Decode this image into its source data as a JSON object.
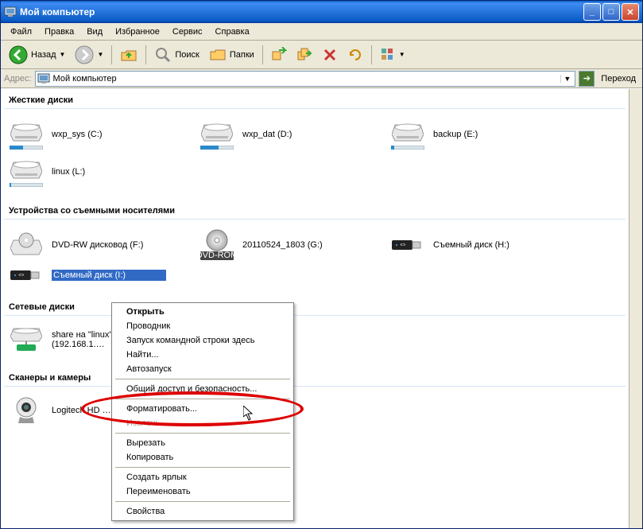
{
  "window": {
    "title": "Мой компьютер",
    "controls": {
      "min": "_",
      "max": "□",
      "close": "✕"
    }
  },
  "menubar": [
    "Файл",
    "Правка",
    "Вид",
    "Избранное",
    "Сервис",
    "Справка"
  ],
  "toolbar": {
    "back": "Назад",
    "search": "Поиск",
    "folders": "Папки"
  },
  "addressbar": {
    "label": "Адрес:",
    "value": "Мой компьютер",
    "go": "Переход"
  },
  "groups": [
    {
      "title": "Жесткие диски",
      "items": [
        {
          "name": "wxp_sys (C:)",
          "type": "hdd",
          "fill": 0.4
        },
        {
          "name": "wxp_dat (D:)",
          "type": "hdd",
          "fill": 0.55
        },
        {
          "name": "backup (E:)",
          "type": "hdd",
          "fill": 0.1
        },
        {
          "name": "linux (L:)",
          "type": "hdd",
          "fill": 0.05
        }
      ]
    },
    {
      "title": "Устройства со съемными носителями",
      "items": [
        {
          "name": "DVD-RW дисковод (F:)",
          "type": "dvdrw"
        },
        {
          "name": "20110524_1803 (G:)",
          "type": "dvdrom",
          "badge": "DVD-ROM"
        },
        {
          "name": "Съемный диск (H:)",
          "type": "usb"
        },
        {
          "name": "Съемный диск (I:)",
          "type": "usb",
          "selected": true
        }
      ]
    },
    {
      "title": "Сетевые диски",
      "items": [
        {
          "name": "share на \"linux\" (Z:)",
          "sub": "(192.168.1.…",
          "type": "netdrive"
        }
      ]
    },
    {
      "title": "Сканеры и камеры",
      "items": [
        {
          "name": "Logitech HD …",
          "type": "webcam"
        }
      ]
    }
  ],
  "context_menu": [
    {
      "label": "Открыть",
      "bold": true
    },
    {
      "label": "Проводник"
    },
    {
      "label": "Запуск командной строки здесь"
    },
    {
      "label": "Найти..."
    },
    {
      "label": "Автозапуск"
    },
    {
      "sep": true
    },
    {
      "label": "Общий доступ и безопасность..."
    },
    {
      "sep": true
    },
    {
      "label": "Форматировать..."
    },
    {
      "label": "Извлечь",
      "disabled": true
    },
    {
      "sep": true
    },
    {
      "label": "Вырезать"
    },
    {
      "label": "Копировать"
    },
    {
      "sep": true
    },
    {
      "label": "Создать ярлык"
    },
    {
      "label": "Переименовать"
    },
    {
      "sep": true
    },
    {
      "label": "Свойства"
    }
  ]
}
